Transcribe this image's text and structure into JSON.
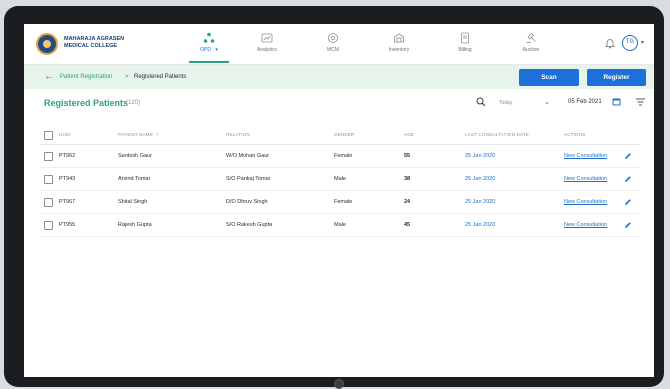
{
  "header": {
    "org_name": "MAHARAJA AGRASEN MEDICAL COLLEGE",
    "nav": [
      {
        "label": "OPD",
        "icon": "opd-icon",
        "active": true
      },
      {
        "label": "Analytics",
        "icon": "analytics-icon"
      },
      {
        "label": "MCM",
        "icon": "mcm-icon"
      },
      {
        "label": "Inventory",
        "icon": "inventory-icon"
      },
      {
        "label": "Billing",
        "icon": "billing-icon"
      },
      {
        "label": "Auction",
        "icon": "auction-icon"
      }
    ],
    "avatar_initials": "TG"
  },
  "breadcrumb": {
    "parent": "Patient Registration",
    "separator": ">",
    "current": "Registered Patients"
  },
  "actions": {
    "scan_label": "Scan",
    "register_label": "Register"
  },
  "page": {
    "title": "Registered Patients",
    "count": "(120)",
    "filter_select": "Today",
    "date": "05 Feb 2021"
  },
  "table": {
    "headers": [
      "UHID",
      "PATIENT NAME",
      "RELATION",
      "GENDER",
      "AGE",
      "LAST CONSULTATION DATE",
      "ACTIONS"
    ],
    "rows": [
      {
        "uhid": "PT962",
        "name": "Santosh Gaur",
        "relation": "W/O Mohan Gaur",
        "gender": "Female",
        "age": "55",
        "date": "25 Jan 2020",
        "action": "New Consultation"
      },
      {
        "uhid": "PT943",
        "name": "Arvind Tomar",
        "relation": "S/O Pankaj Tomar",
        "gender": "Male",
        "age": "38",
        "date": "25 Jan 2020",
        "action": "New Consultation"
      },
      {
        "uhid": "PT967",
        "name": "Shital Singh",
        "relation": "D/O Dhruv Singh",
        "gender": "Female",
        "age": "24",
        "date": "25 Jan 2020",
        "action": "New Consultation"
      },
      {
        "uhid": "PT955",
        "name": "Rajesh Gupta",
        "relation": "S/O Rakesh Gupta",
        "gender": "Male",
        "age": "45",
        "date": "25 Jan 2020",
        "action": "New Consultation"
      }
    ]
  },
  "colors": {
    "accent": "#1f6fd9",
    "brand_green": "#2aa57b",
    "subbar_bg": "#e6f4ec"
  }
}
